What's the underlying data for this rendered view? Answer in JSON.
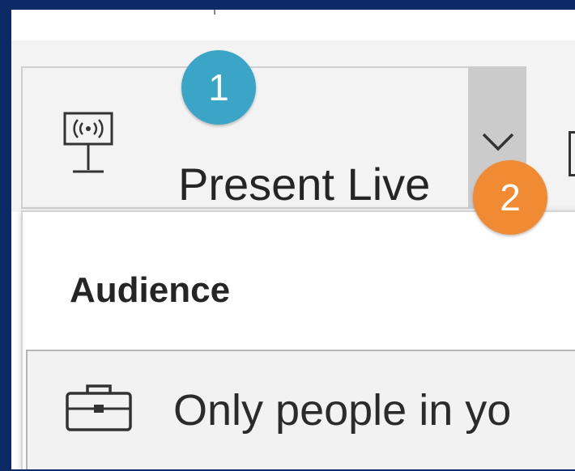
{
  "ribbon": {
    "present_button": {
      "label": "Present Live",
      "icon": "presenter-screen-icon"
    },
    "dropdown_toggle": {
      "icon": "chevron-down-icon"
    }
  },
  "dropdown": {
    "heading": "Audience",
    "options": [
      {
        "label": "Only people in yo",
        "icon": "briefcase-icon"
      }
    ]
  },
  "callouts": [
    {
      "number": "1",
      "color": "#3aa5c6"
    },
    {
      "number": "2",
      "color": "#f08b34"
    }
  ],
  "colors": {
    "frame_border": "#0e2a66",
    "ribbon_bg": "#f3f3f3",
    "toggle_bg": "#cbcbcb",
    "text": "#252525"
  }
}
